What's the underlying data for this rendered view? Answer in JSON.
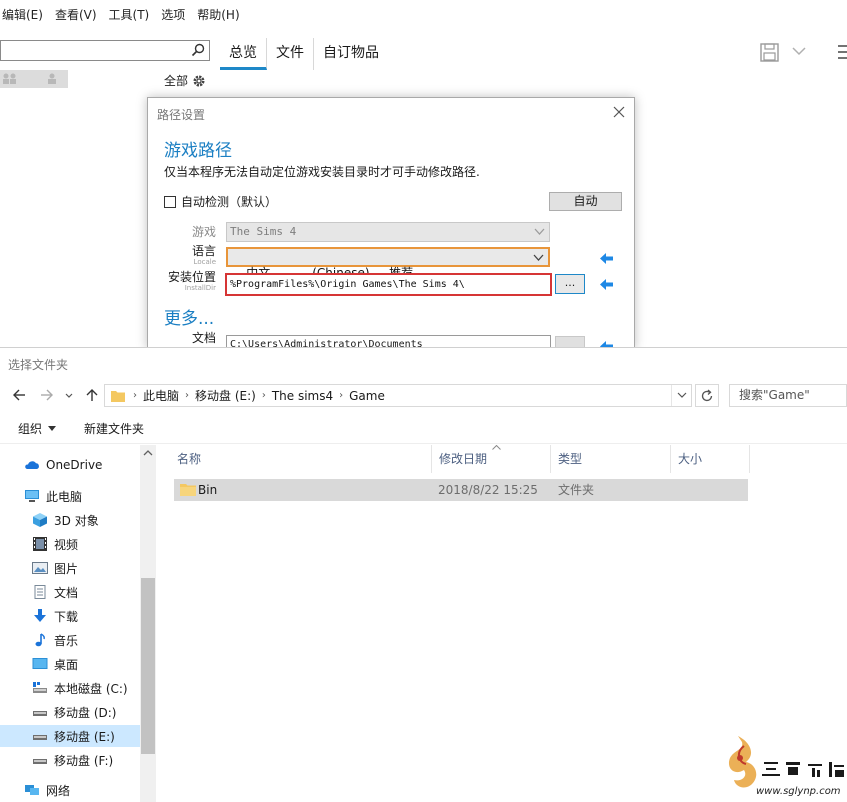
{
  "app": {
    "menu": [
      "编辑(E)",
      "查看(V)",
      "工具(T)",
      "选项",
      "帮助(H)"
    ],
    "tabs": [
      "总览",
      "文件",
      "自订物品"
    ],
    "filter_label": "全部"
  },
  "path_dialog": {
    "title": "路径设置",
    "heading": "游戏路径",
    "description": "仅当本程序无法自动定位游戏安装目录时才可手动修改路径.",
    "auto_detect_label": "自动检测（默认）",
    "auto_detect_checked": false,
    "auto_button": "自动",
    "game_label": "游戏",
    "game_value": "The Sims 4",
    "language_label": "语言",
    "language_sublabel": "Locale",
    "language_value": "中文           (Chinese)  -  推荐",
    "install_label": "安装位置",
    "install_sublabel": "InstallDir",
    "install_value": "%ProgramFiles%\\Origin Games\\The Sims 4\\",
    "browse_button": "...",
    "more_heading": "更多...",
    "documents_label": "文档",
    "documents_value": "C:\\Users\\Administrator\\Documents",
    "colors": {
      "accent": "#1b7fc3",
      "language_border": "#e8953a",
      "install_border": "#d63535"
    }
  },
  "folder_browser": {
    "title": "选择文件夹",
    "breadcrumb": [
      "此电脑",
      "移动盘 (E:)",
      "The sims4",
      "Game"
    ],
    "search_placeholder": "搜索\"Game\"",
    "organize_label": "组织",
    "new_folder_label": "新建文件夹",
    "tree": [
      {
        "label": "OneDrive",
        "icon": "cloud-icon"
      },
      {
        "label": "此电脑",
        "icon": "computer-icon"
      },
      {
        "label": "3D 对象",
        "icon": "cube-icon"
      },
      {
        "label": "视频",
        "icon": "video-icon"
      },
      {
        "label": "图片",
        "icon": "picture-icon"
      },
      {
        "label": "文档",
        "icon": "document-icon"
      },
      {
        "label": "下载",
        "icon": "download-icon"
      },
      {
        "label": "音乐",
        "icon": "music-icon"
      },
      {
        "label": "桌面",
        "icon": "desktop-icon"
      },
      {
        "label": "本地磁盘 (C:)",
        "icon": "system-drive-icon"
      },
      {
        "label": "移动盘 (D:)",
        "icon": "drive-icon"
      },
      {
        "label": "移动盘 (E:)",
        "icon": "drive-icon",
        "selected": true
      },
      {
        "label": "移动盘 (F:)",
        "icon": "drive-icon"
      },
      {
        "label": "网络",
        "icon": "network-icon"
      }
    ],
    "columns": [
      "名称",
      "修改日期",
      "类型",
      "大小"
    ],
    "rows": [
      {
        "name": "Bin",
        "modified": "2018/8/22 15:25",
        "type": "文件夹",
        "size": ""
      }
    ]
  }
}
